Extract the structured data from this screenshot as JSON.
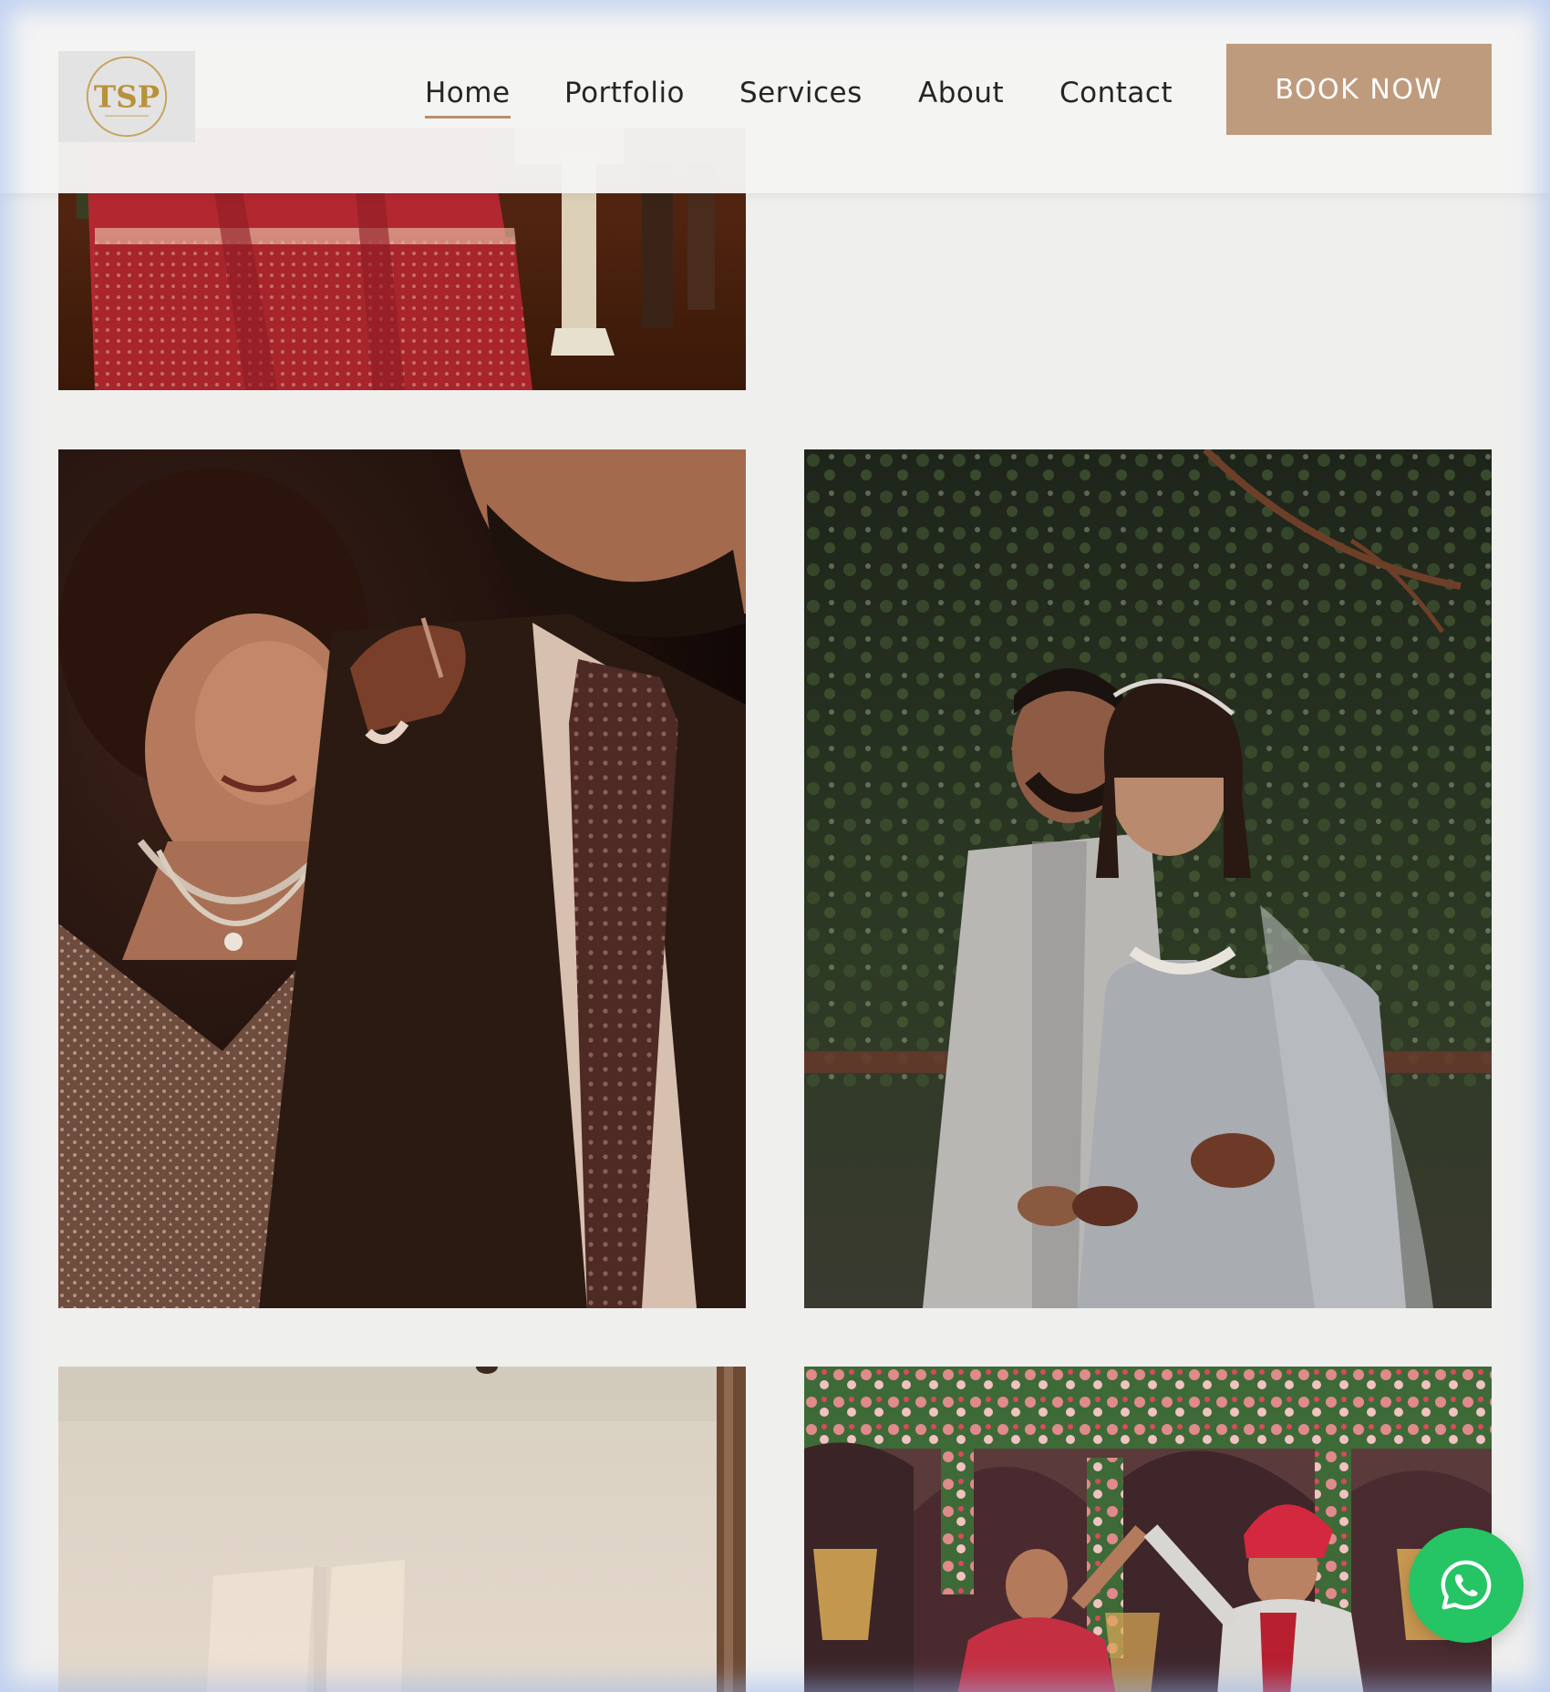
{
  "header": {
    "logo_icon": "tsp-monogram-logo",
    "logo_text": "TSP",
    "nav": [
      {
        "id": "home",
        "label": "Home",
        "active": true
      },
      {
        "id": "portfolio",
        "label": "Portfolio",
        "active": false
      },
      {
        "id": "services",
        "label": "Services",
        "active": false
      },
      {
        "id": "about",
        "label": "About",
        "active": false
      },
      {
        "id": "contact",
        "label": "Contact",
        "active": false
      }
    ],
    "book_button": "BOOK NOW"
  },
  "gallery": {
    "photos": [
      {
        "id": "bridal-lehenga",
        "subject": "bride in red embroidered lehenga beside groom at mandap"
      },
      {
        "id": "couple-closeup",
        "subject": "bride resting head on groom's shoulder, groom in suit and tie"
      },
      {
        "id": "couple-garden",
        "subject": "couple in silver outfits holding hands under trees"
      },
      {
        "id": "window-light",
        "subject": "warm light falling through window onto wall"
      },
      {
        "id": "stage-ceremony",
        "subject": "couple on floral stage with chandeliers"
      }
    ]
  },
  "floating": {
    "whatsapp_icon": "whatsapp-icon"
  },
  "colors": {
    "page_bg": "#efefee",
    "accent": "#bf9b7d",
    "nav_underline": "#b98f6b",
    "whatsapp": "#25c464",
    "logo_gold": "#b8923a"
  }
}
